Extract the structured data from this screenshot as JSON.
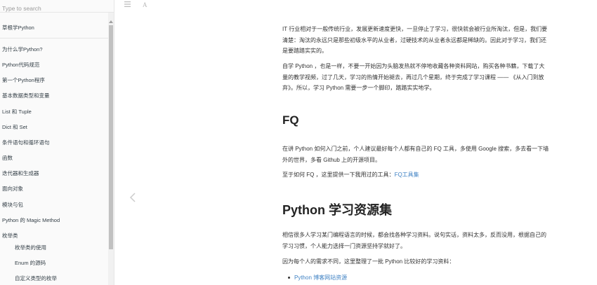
{
  "search": {
    "placeholder": "Type to search"
  },
  "sidebar": {
    "items": [
      {
        "label": "草根学Python",
        "level": 0
      },
      {
        "label": "为什么学Python?",
        "level": 0
      },
      {
        "label": "Python代码规范",
        "level": 0
      },
      {
        "label": "第一个Python程序",
        "level": 0
      },
      {
        "label": "基本数据类型和变量",
        "level": 0
      },
      {
        "label": "List 和 Tuple",
        "level": 0
      },
      {
        "label": "Dict 和 Set",
        "level": 0
      },
      {
        "label": "条件语句和循环语句",
        "level": 0
      },
      {
        "label": "函数",
        "level": 0
      },
      {
        "label": "迭代器和生成器",
        "level": 0
      },
      {
        "label": "面向对象",
        "level": 0
      },
      {
        "label": "模块与包",
        "level": 0
      },
      {
        "label": "Python 的 Magic Method",
        "level": 0
      },
      {
        "label": "枚举类",
        "level": 0
      },
      {
        "label": "枚举类的使用",
        "level": 1
      },
      {
        "label": "Enum 的源码",
        "level": 1
      },
      {
        "label": "自定义类型的枚举",
        "level": 1
      }
    ]
  },
  "toolbar": {
    "menu_icon": "menu-icon",
    "font_icon": "font-settings-icon",
    "font_glyph": "A"
  },
  "nav": {
    "prev_icon": "chevron-left-icon"
  },
  "content": {
    "para1_line1": "IT 行业相对于一般传统行业，发展更新速度更快，一旦停止了学习，很快就会被行业所淘汰，但是，我们要",
    "para1_line2": "清楚：淘汰的永远只是那些初级水平的从业者，过硬技术的从业者永远都是稀缺的。因此对于学习，我们还",
    "para1_line3": "是要踏踏实实的。",
    "para2_line1": "自学 Python ，也是一样，不要一开始因为头脑发热就不停地收藏各种资料网站，购买各种书籍，下载了大",
    "para2_line2": "量的教学视频，过了几天，学习的热情开始褪去，再过几个星期，终于完成了学习课程 —— 《从入门到放",
    "para2_line3": "弃》。所以，学习 Python 需要一步一个脚印，踏踏实实地学。",
    "heading_fq": "FQ",
    "para3_line1": "在讲 Python 如何入门之前，个人建议最好每个人都有自己的 FQ 工具，多使用 Google 搜索，多去看一下墙",
    "para3_line2": "外的世界，多看 Github 上的开源项目。",
    "para4_text": "至于如何 FQ ，这里提供一下我用过的工具：",
    "para4_link": "FQ工具集",
    "heading_resources": "Python 学习资源集",
    "para5_line1": "相信很多人学习某门编程语言的时候，都会找各种学习资料。说句实话，资料太多，反而没用，根据自己的",
    "para5_line2": "学习习惯，个人能力选择一门资源坚持学就好了。",
    "para6": "因为每个人的需求不同，这里整理了一批 Python 比较好的学习资料：",
    "bullet1": "Python 博客网站资源"
  }
}
